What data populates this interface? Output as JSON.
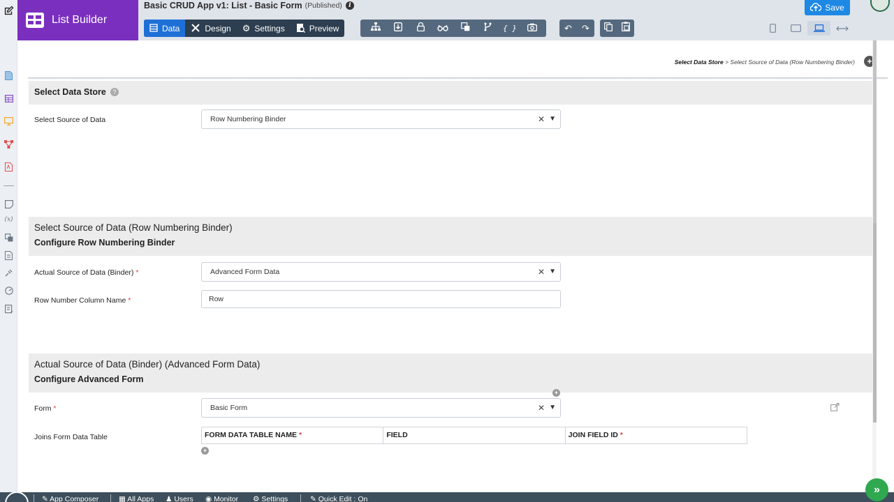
{
  "builder": {
    "title": "List Builder"
  },
  "app": {
    "title": "Basic CRUD App v1: List - Basic Form",
    "status": "(Published)"
  },
  "tabs": [
    {
      "label": "Data",
      "icon": "data-icon"
    },
    {
      "label": "Design",
      "icon": "design-icon"
    },
    {
      "label": "Settings",
      "icon": "gear-icon"
    },
    {
      "label": "Preview",
      "icon": "preview-icon"
    }
  ],
  "toolbar_icons": [
    "tree-icon",
    "export-icon",
    "lock-icon",
    "glasses-icon",
    "translate-icon",
    "branch-icon",
    "braces-icon",
    "camera-icon"
  ],
  "save": {
    "label": "Save"
  },
  "accent_color": "#1e70d7",
  "builder_color": "#7b2fbf",
  "breadcrumb": {
    "first": "Select Data Store",
    "sep": ">",
    "second": "Select Source of Data (Row Numbering Binder)"
  },
  "section1": {
    "title": "Select Data Store",
    "field_label": "Select Source of Data",
    "field_value": "Row Numbering Binder"
  },
  "section2": {
    "title": "Select Source of Data (Row Numbering Binder)",
    "subtitle": "Configure Row Numbering Binder",
    "binder_label": "Actual Source of Data (Binder)",
    "binder_value": "Advanced Form Data",
    "rownum_label": "Row Number Column Name",
    "rownum_value": "Row"
  },
  "section3": {
    "title": "Actual Source of Data (Binder) (Advanced Form Data)",
    "subtitle": "Configure Advanced Form",
    "form_label": "Form",
    "form_value": "Basic Form",
    "joins_label": "Joins Form Data Table",
    "columns": [
      "FORM DATA TABLE NAME",
      "FIELD",
      "JOIN FIELD ID"
    ]
  },
  "bottombar": {
    "items": [
      "App Composer",
      "All Apps",
      "Users",
      "Monitor",
      "Settings",
      "Quick Edit : On"
    ]
  }
}
